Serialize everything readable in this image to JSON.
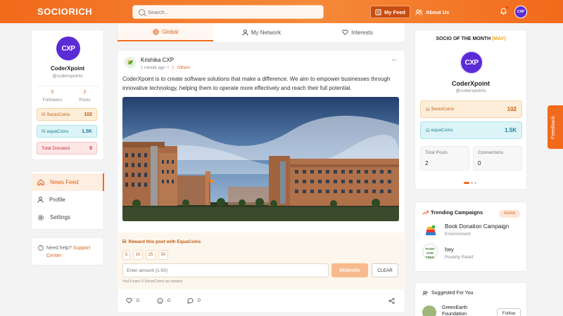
{
  "header": {
    "logo": "SOCIORICH",
    "search_placeholder": "Search...",
    "my_feed_label": "My Feed",
    "about_label": "About Us",
    "avatar_text": "CXP"
  },
  "profile": {
    "avatar_text": "CXP",
    "name": "CoderXpoint",
    "handle": "@coderxpoints",
    "followers_count": "0",
    "followers_label": "Followers",
    "posts_count": "2",
    "posts_label": "Posts",
    "socio_label": "SocioCoins",
    "socio_value": "102",
    "equa_label": "equaCoins",
    "equa_value": "1.5K",
    "donated_label": "Total Donated",
    "donated_value": "0"
  },
  "sidebar": {
    "items": [
      {
        "label": "News Feed"
      },
      {
        "label": "Profile"
      },
      {
        "label": "Settings"
      }
    ],
    "help_text": "Need help?",
    "help_link": "Support Center"
  },
  "tabs": [
    {
      "label": "Global"
    },
    {
      "label": "My Network"
    },
    {
      "label": "Interests"
    }
  ],
  "post": {
    "author": "Krishika CXP",
    "time": "1 minute ago",
    "separator": "•",
    "category": "Others",
    "text": "CoderXpoint is to create software solutions that make a difference. We aim to empower businesses through innovative technology, helping them to operate more effectively and reach their full potential.",
    "reward_title": "Reward this post with EquaCoins",
    "amounts": [
      "5",
      "10",
      "25",
      "50"
    ],
    "amount_placeholder": "Enter amount (1-50)",
    "reward_button": "REWARD",
    "clear_button": "CLEAR",
    "earn_note": "You'll earn 0 SocioCoins as reward",
    "likes": "0",
    "comments": "0",
    "shares": "0"
  },
  "socio_month": {
    "title": "SOCIO OF THE MONTH",
    "month": "(MAY)",
    "avatar_text": "CXP",
    "name": "CoderXpoint",
    "handle": "@coderxpoints",
    "socio_label": "SocioCoins",
    "socio_value": "102",
    "equa_label": "equaCoins",
    "equa_value": "1.5K",
    "total_posts_label": "Total Posts",
    "total_posts_value": "2",
    "connections_label": "Connections",
    "connections_value": "0"
  },
  "campaigns": {
    "title": "Trending Campaigns",
    "badge": "Active",
    "items": [
      {
        "name": "Book Donation Campaign",
        "category": "Environment"
      },
      {
        "name": "hey",
        "category": "Poverty Relief",
        "logo_text": "FOOD FOR FREE"
      }
    ]
  },
  "suggested": {
    "title": "Suggested For You",
    "items": [
      {
        "name": "GreenEarth Foundation",
        "button": "Follow"
      }
    ]
  },
  "feedback_label": "Feedback",
  "colors": {
    "brand": "#f26a1b",
    "purple": "#5b2bd6"
  }
}
